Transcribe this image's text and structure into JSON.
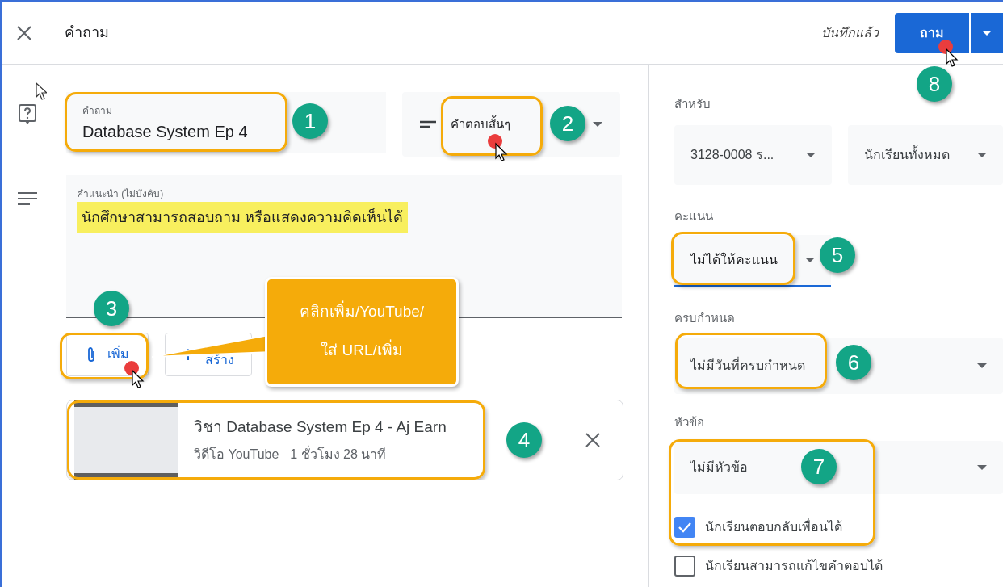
{
  "header": {
    "title": "คำถาม",
    "saved_status": "บันทึกแล้ว",
    "ask_button": "ถาม"
  },
  "question": {
    "label": "คำถาม",
    "value": "Database System Ep 4"
  },
  "answer_type": {
    "value": "คำตอบสั้นๆ"
  },
  "instructions": {
    "label": "คำแนะนำ (ไม่บังคับ)",
    "value": "นักศึกษาสามารถสอบถาม หรือแสดงความคิดเห็นได้"
  },
  "attach_buttons": [
    {
      "kind": "add",
      "label": "เพิ่ม"
    },
    {
      "kind": "create",
      "label": "สร้าง"
    }
  ],
  "attachment": {
    "title": "วิชา Database System Ep 4 - Aj Earn",
    "type": "วิดีโอ YouTube",
    "duration": "1 ชั่วโมง 28 นาที"
  },
  "settings": {
    "for_label": "สำหรับ",
    "class_value": "3128-0008 ร...",
    "students_value": "นักเรียนทั้งหมด",
    "points_label": "คะแนน",
    "points_value": "ไม่ได้ให้คะแนน",
    "due_label": "ครบกำหนด",
    "due_value": "ไม่มีวันที่ครบกำหนด",
    "topic_label": "หัวข้อ",
    "topic_value": "ไม่มีหัวข้อ",
    "options": [
      {
        "label": "นักเรียนตอบกลับเพื่อนได้",
        "checked": true
      },
      {
        "label": "นักเรียนสามารถแก้ไขคำตอบได้",
        "checked": false
      }
    ]
  },
  "annotations": {
    "badges": [
      "1",
      "2",
      "3",
      "4",
      "5",
      "6",
      "7",
      "8"
    ],
    "callout": "คลิกเพิ่ม/YouTube/\nใส่ URL/เพิ่ม"
  }
}
